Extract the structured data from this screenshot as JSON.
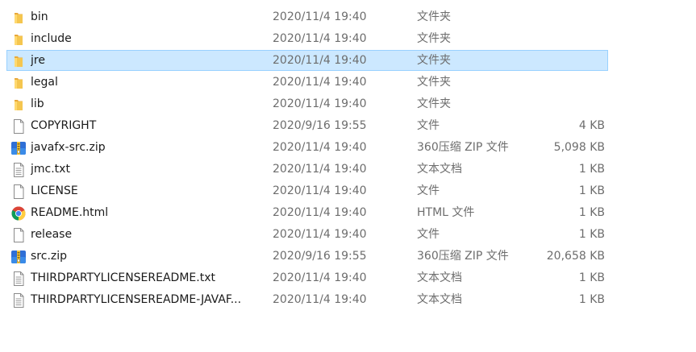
{
  "files": [
    {
      "name": "bin",
      "date": "2020/11/4 19:40",
      "type": "文件夹",
      "size": "",
      "icon": "folder-icon",
      "selected": false
    },
    {
      "name": "include",
      "date": "2020/11/4 19:40",
      "type": "文件夹",
      "size": "",
      "icon": "folder-icon",
      "selected": false
    },
    {
      "name": "jre",
      "date": "2020/11/4 19:40",
      "type": "文件夹",
      "size": "",
      "icon": "folder-icon",
      "selected": true
    },
    {
      "name": "legal",
      "date": "2020/11/4 19:40",
      "type": "文件夹",
      "size": "",
      "icon": "folder-icon",
      "selected": false
    },
    {
      "name": "lib",
      "date": "2020/11/4 19:40",
      "type": "文件夹",
      "size": "",
      "icon": "folder-icon",
      "selected": false
    },
    {
      "name": "COPYRIGHT",
      "date": "2020/9/16 19:55",
      "type": "文件",
      "size": "4 KB",
      "icon": "file-icon",
      "selected": false
    },
    {
      "name": "javafx-src.zip",
      "date": "2020/11/4 19:40",
      "type": "360压缩 ZIP 文件",
      "size": "5,098 KB",
      "icon": "zip-archive-icon",
      "selected": false
    },
    {
      "name": "jmc.txt",
      "date": "2020/11/4 19:40",
      "type": "文本文档",
      "size": "1 KB",
      "icon": "text-file-icon",
      "selected": false
    },
    {
      "name": "LICENSE",
      "date": "2020/11/4 19:40",
      "type": "文件",
      "size": "1 KB",
      "icon": "file-icon",
      "selected": false
    },
    {
      "name": "README.html",
      "date": "2020/11/4 19:40",
      "type": "HTML 文件",
      "size": "1 KB",
      "icon": "chrome-icon",
      "selected": false
    },
    {
      "name": "release",
      "date": "2020/11/4 19:40",
      "type": "文件",
      "size": "1 KB",
      "icon": "file-icon",
      "selected": false
    },
    {
      "name": "src.zip",
      "date": "2020/9/16 19:55",
      "type": "360压缩 ZIP 文件",
      "size": "20,658 KB",
      "icon": "zip-archive-icon",
      "selected": false
    },
    {
      "name": "THIRDPARTYLICENSEREADME.txt",
      "date": "2020/11/4 19:40",
      "type": "文本文档",
      "size": "1 KB",
      "icon": "text-file-icon",
      "selected": false
    },
    {
      "name": "THIRDPARTYLICENSEREADME-JAVAF...",
      "date": "2020/11/4 19:40",
      "type": "文本文档",
      "size": "1 KB",
      "icon": "text-file-icon",
      "selected": false
    }
  ],
  "colors": {
    "selection_fill": "#cce8ff",
    "selection_border": "#99d1ff",
    "folder": "#f3c14b"
  }
}
